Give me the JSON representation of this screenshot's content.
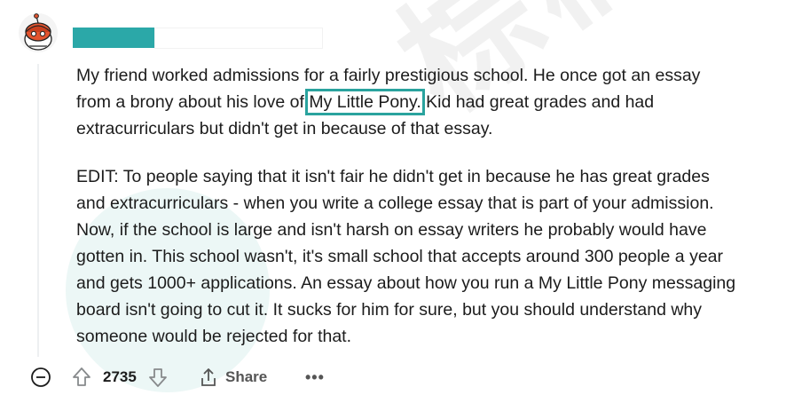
{
  "watermark": {
    "text": "棕榈大道"
  },
  "comment": {
    "username": "",
    "paragraphs": [
      {
        "lines": [
          [
            {
              "text": "My friend worked admissions for a fairly prestigious school. He once got an essay"
            }
          ],
          [
            {
              "text": "from a brony about his love of "
            },
            {
              "text": "My Little Pony.",
              "highlight": true
            },
            {
              "text": " Kid had great grades and had"
            }
          ],
          [
            {
              "text": "extracurriculars but didn't get in because of that essay."
            }
          ]
        ]
      },
      {
        "lines": [
          [
            {
              "text": "EDIT: To people saying that it isn't fair he didn't get in because he has great grades"
            }
          ],
          [
            {
              "text": "and extracurriculars - when you write a college essay that is part of your admission."
            }
          ],
          [
            {
              "text": "Now, if the school is large and isn't harsh on essay writers he probably would have"
            }
          ],
          [
            {
              "text": "gotten in. This school wasn't, it's small school that accepts around 300 people a year"
            }
          ],
          [
            {
              "text": "and gets 1000+ applications. An essay about how you run a My Little Pony messaging"
            }
          ],
          [
            {
              "text": "board isn't going to cut it. It sucks for him for sure, but you should understand why"
            }
          ],
          [
            {
              "text": "someone would be rejected for that."
            }
          ]
        ]
      }
    ]
  },
  "actions": {
    "score": "2735",
    "share_label": "Share",
    "more_label": "•••"
  },
  "colors": {
    "accent": "#2ba8a8",
    "highlight_outline": "#2aa39e",
    "text": "#1c1c1c",
    "muted": "#555555"
  },
  "icons": [
    "reddit-snoo-avatar-icon",
    "collapse-minus-icon",
    "upvote-arrow-icon",
    "downvote-arrow-icon",
    "share-icon",
    "more-options-icon"
  ]
}
